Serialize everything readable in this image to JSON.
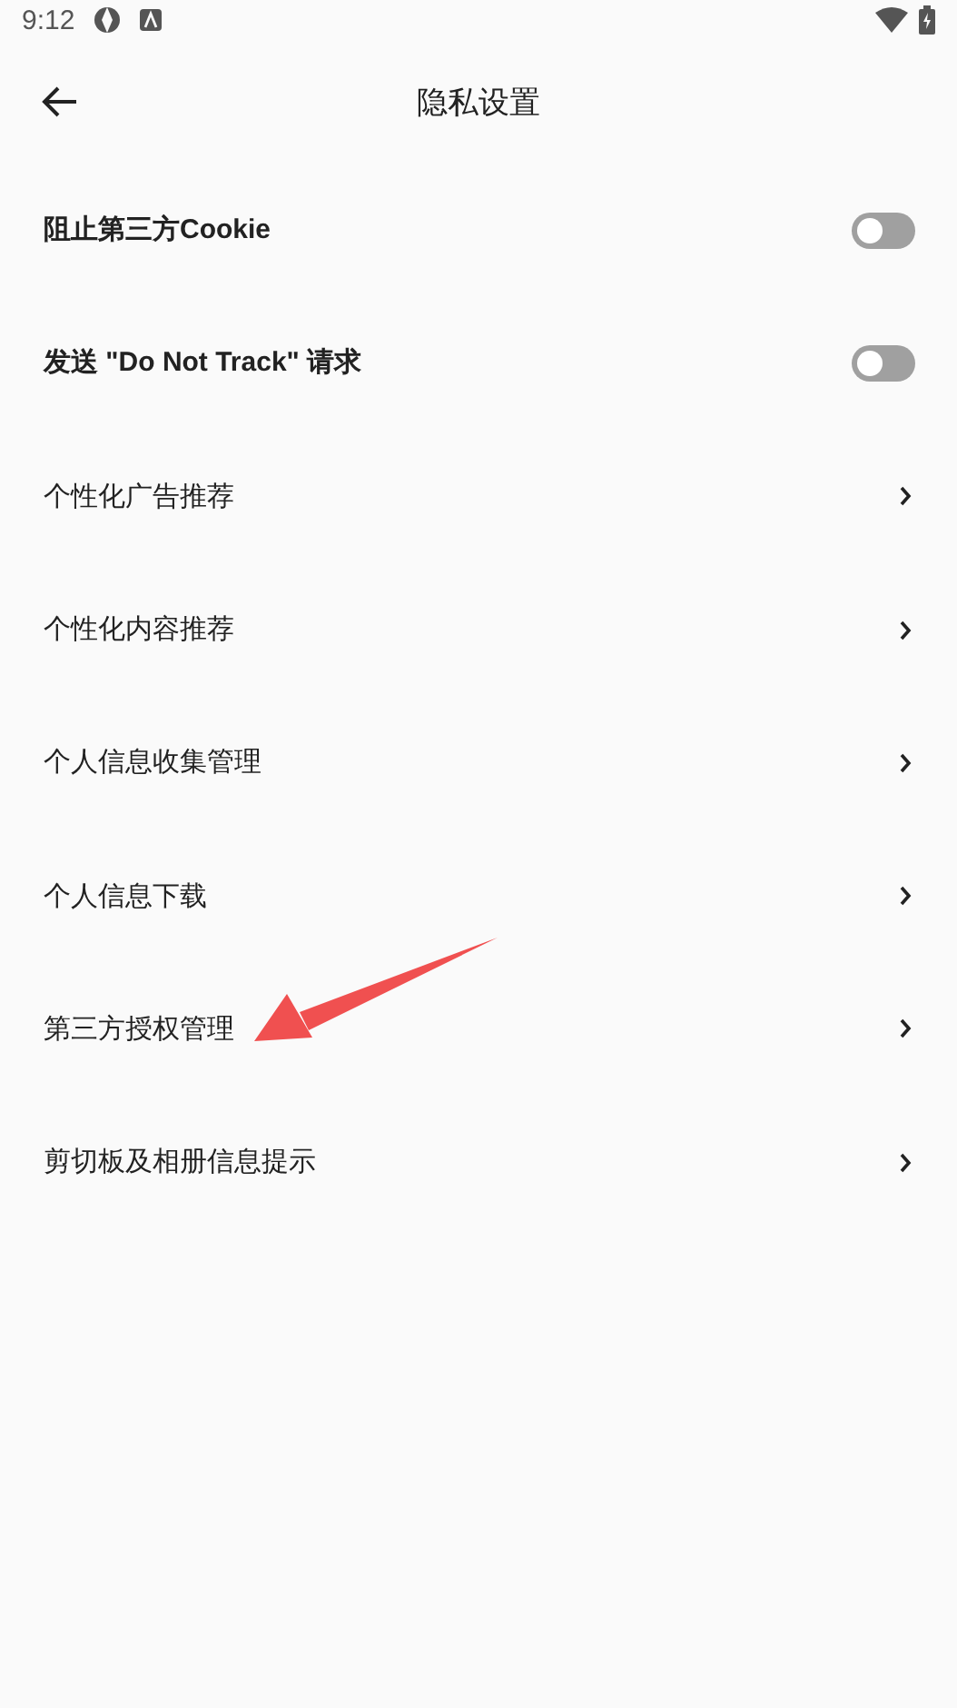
{
  "status_bar": {
    "time": "9:12"
  },
  "header": {
    "title": "隐私设置"
  },
  "items": [
    {
      "kind": "toggle",
      "label": "阻止第三方Cookie",
      "on": false
    },
    {
      "kind": "toggle",
      "label": "发送 \"Do Not Track\" 请求",
      "on": false
    },
    {
      "kind": "link",
      "label": "个性化广告推荐"
    },
    {
      "kind": "link",
      "label": "个性化内容推荐"
    },
    {
      "kind": "link",
      "label": "个人信息收集管理"
    },
    {
      "kind": "link",
      "label": "个人信息下载"
    },
    {
      "kind": "link",
      "label": "第三方授权管理"
    },
    {
      "kind": "link",
      "label": "剪切板及相册信息提示"
    }
  ]
}
